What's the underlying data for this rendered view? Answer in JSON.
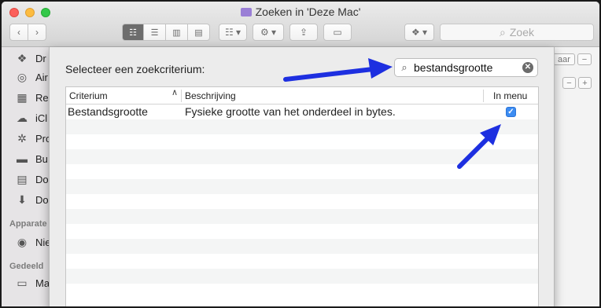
{
  "window": {
    "title": "Zoeken in 'Deze Mac'"
  },
  "toolbar": {
    "back_icon": "chevron-left",
    "forward_icon": "chevron-right",
    "search_placeholder": "Zoek"
  },
  "sidebar": {
    "items_top": [
      {
        "label": "Dr",
        "icon": "dropbox-icon"
      },
      {
        "label": "Air",
        "icon": "airdrop-icon"
      },
      {
        "label": "Re",
        "icon": "recent-icon"
      },
      {
        "label": "iCl",
        "icon": "icloud-icon"
      },
      {
        "label": "Pro",
        "icon": "applications-icon"
      },
      {
        "label": "Bu",
        "icon": "desktop-icon"
      },
      {
        "label": "Do",
        "icon": "document-icon"
      },
      {
        "label": "Do",
        "icon": "download-icon"
      }
    ],
    "section_devices": "Apparate",
    "device_item": {
      "label": "Nie",
      "icon": "disc-icon"
    },
    "section_shared": "Gedeeld",
    "shared_item": {
      "label": "Ma",
      "icon": "computer-icon"
    }
  },
  "right_panel": {
    "partial_button": "aar"
  },
  "dialog": {
    "label": "Selecteer een zoekcriterium:",
    "search_value": "bestandsgrootte",
    "columns": {
      "criterium": "Criterium",
      "beschrijving": "Beschrijving",
      "in_menu": "In menu"
    },
    "rows": [
      {
        "criterium": "Bestandsgrootte",
        "beschrijving": "Fysieke grootte van het onderdeel in bytes.",
        "in_menu": true
      }
    ],
    "empty_rows": 12
  },
  "colors": {
    "arrow": "#1d2fe0",
    "checkbox": "#3c8cf2"
  }
}
